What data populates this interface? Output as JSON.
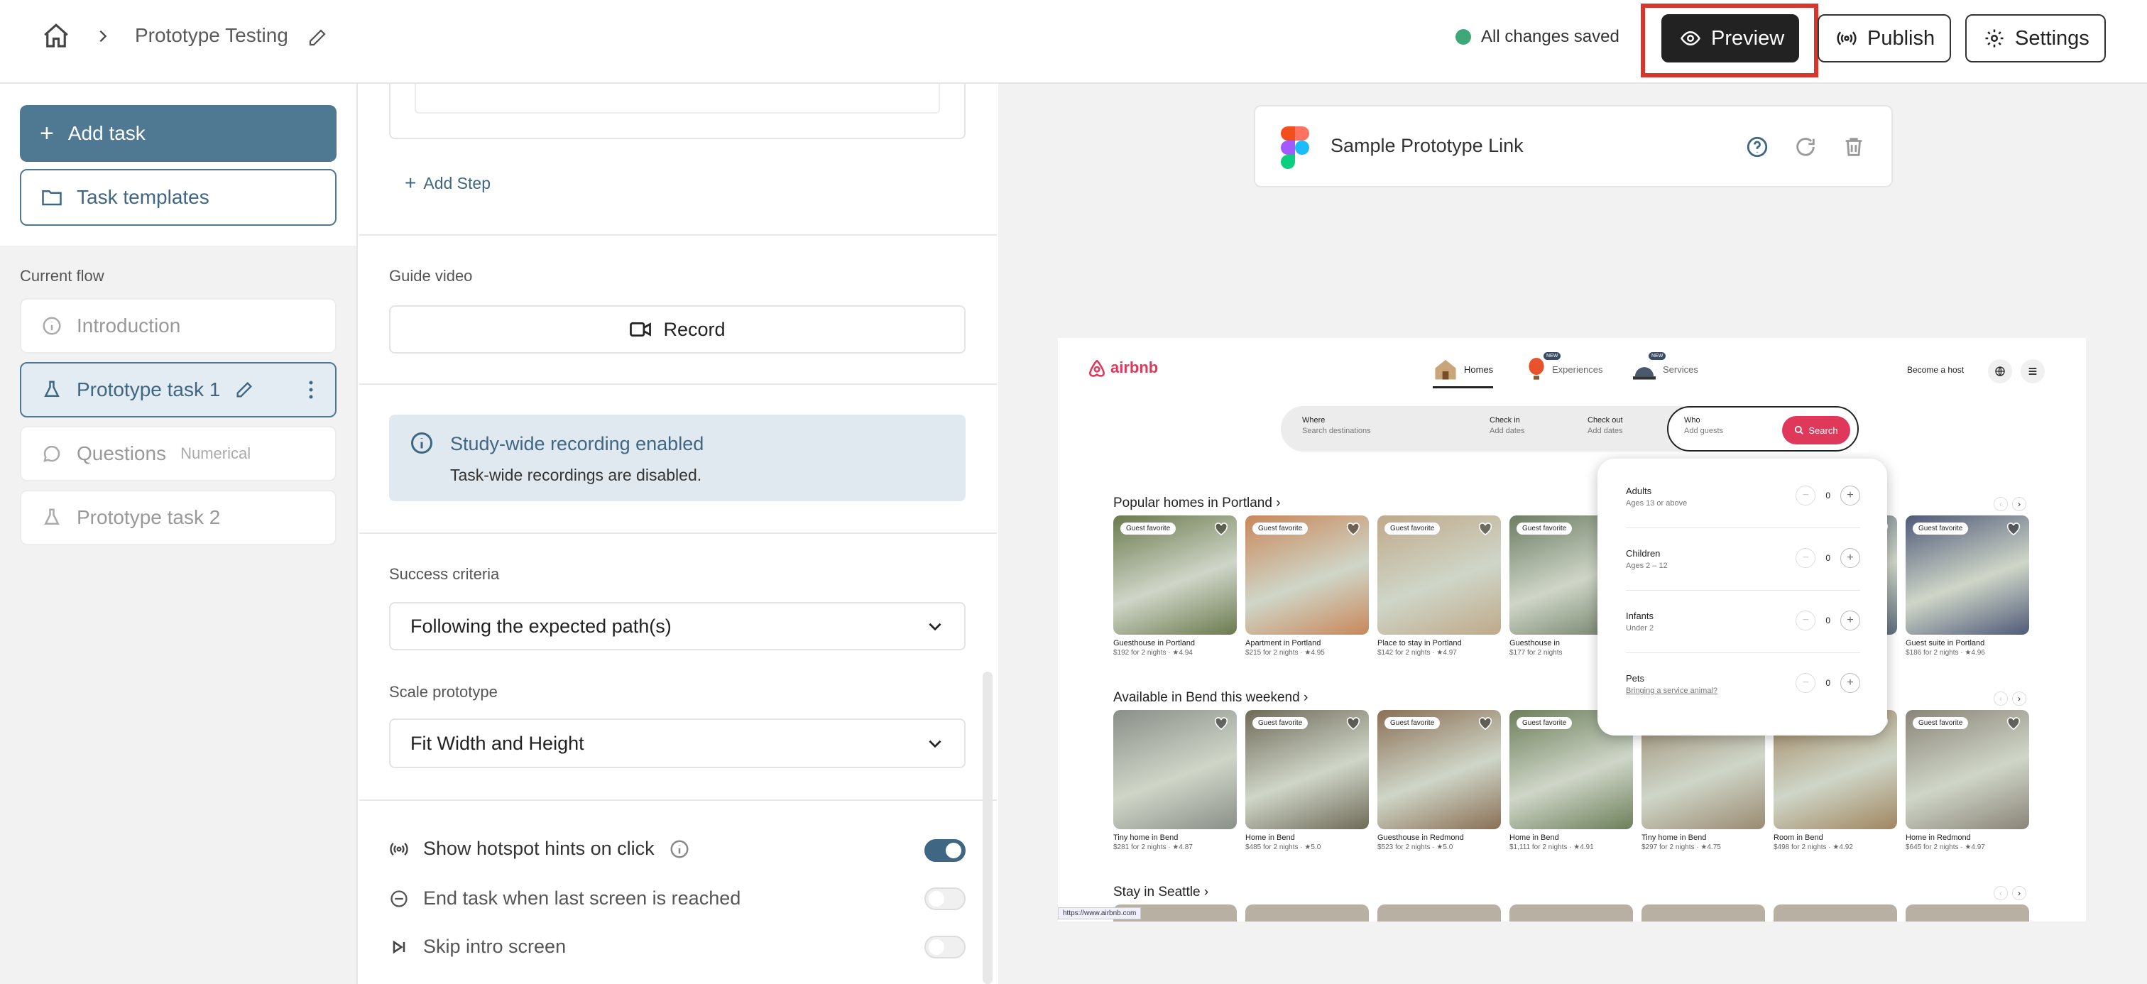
{
  "header": {
    "breadcrumb_title": "Prototype Testing",
    "save_status": "All changes saved",
    "preview_label": "Preview",
    "publish_label": "Publish",
    "settings_label": "Settings"
  },
  "sidebar": {
    "add_task_label": "Add task",
    "task_templates_label": "Task templates",
    "current_flow_label": "Current flow",
    "items": [
      {
        "label": "Introduction",
        "tag": ""
      },
      {
        "label": "Prototype task 1",
        "tag": ""
      },
      {
        "label": "Questions",
        "tag": "Numerical"
      },
      {
        "label": "Prototype task 2",
        "tag": ""
      }
    ]
  },
  "task": {
    "add_step_label": "Add Step",
    "guide_video_label": "Guide video",
    "record_label": "Record",
    "info_title": "Study-wide recording enabled",
    "info_text": "Task-wide recordings are disabled.",
    "success_criteria_label": "Success criteria",
    "success_criteria_value": "Following the expected path(s)",
    "scale_label": "Scale prototype",
    "scale_value": "Fit Width and Height",
    "toggles": [
      {
        "label": "Show hotspot hints on click",
        "on": true
      },
      {
        "label": "End task when last screen is reached",
        "on": false
      },
      {
        "label": "Skip intro screen",
        "on": false
      }
    ]
  },
  "prototype": {
    "link_label": "Sample Prototype Link"
  },
  "airbnb": {
    "logo": "airbnb",
    "nav": [
      "Homes",
      "Experiences",
      "Services"
    ],
    "new_badge": "NEW",
    "become_host": "Become a host",
    "search": {
      "where_label": "Where",
      "where_ph": "Search destinations",
      "checkin_label": "Check in",
      "checkin_ph": "Add dates",
      "checkout_label": "Check out",
      "checkout_ph": "Add dates",
      "who_label": "Who",
      "who_ph": "Add guests",
      "button": "Search"
    },
    "sections": [
      {
        "title": "Popular homes in Portland ›",
        "cards": [
          {
            "badge": "Guest favorite",
            "title": "Guesthouse in Portland",
            "sub": "$192 for 2 nights · ★4.94",
            "color": "#6b7a4e"
          },
          {
            "badge": "Guest favorite",
            "title": "Apartment in Portland",
            "sub": "$215 for 2 nights · ★4.95",
            "color": "#c9875a"
          },
          {
            "badge": "Guest favorite",
            "title": "Place to stay in Portland",
            "sub": "$142 for 2 nights · ★4.97",
            "color": "#bfa98a"
          },
          {
            "badge": "Guest favorite",
            "title": "Guesthouse in",
            "sub": "$177 for 2 nights",
            "color": "#6d7d63"
          },
          {
            "badge": "",
            "title": "",
            "sub": "",
            "color": "#7c8c99"
          },
          {
            "badge": "",
            "title": "",
            "sub": "",
            "color": "#5d6e7d"
          },
          {
            "badge": "Guest favorite",
            "title": "Guest suite in Portland",
            "sub": "$186 for 2 nights · ★4.96",
            "color": "#4f5a78"
          }
        ]
      },
      {
        "title": "Available in Bend this weekend ›",
        "cards": [
          {
            "badge": "",
            "title": "Tiny home in Bend",
            "sub": "$281 for 2 nights · ★4.87",
            "color": "#8a8f88"
          },
          {
            "badge": "Guest favorite",
            "title": "Home in Bend",
            "sub": "$485 for 2 nights · ★5.0",
            "color": "#6f6a58"
          },
          {
            "badge": "Guest favorite",
            "title": "Guesthouse in Redmond",
            "sub": "$523 for 2 nights · ★5.0",
            "color": "#8a6f55"
          },
          {
            "badge": "Guest favorite",
            "title": "Home in Bend",
            "sub": "$1,111 for 2 nights · ★4.91",
            "color": "#6c7f5a"
          },
          {
            "badge": "",
            "title": "Tiny home in Bend",
            "sub": "$297 for 2 nights · ★4.75",
            "color": "#9a8a72"
          },
          {
            "badge": "Guest favorite",
            "title": "Room in Bend",
            "sub": "$498 for 2 nights · ★4.92",
            "color": "#a08660"
          },
          {
            "badge": "Guest favorite",
            "title": "Home in Redmond",
            "sub": "$645 for 2 nights · ★4.97",
            "color": "#8a8478"
          }
        ]
      },
      {
        "title": "Stay in Seattle ›",
        "cards": []
      }
    ],
    "guests": [
      {
        "title": "Adults",
        "sub": "Ages 13 or above",
        "count": "0"
      },
      {
        "title": "Children",
        "sub": "Ages 2 – 12",
        "count": "0"
      },
      {
        "title": "Infants",
        "sub": "Under 2",
        "count": "0"
      },
      {
        "title": "Pets",
        "sub": "Bringing a service animal?",
        "count": "0"
      }
    ],
    "status_url": "https://www.airbnb.com"
  },
  "colors": {
    "accent": "#4f7893",
    "highlight": "#d8362c",
    "airbnb": "#e0385a",
    "saved_dot": "#3fa878"
  }
}
